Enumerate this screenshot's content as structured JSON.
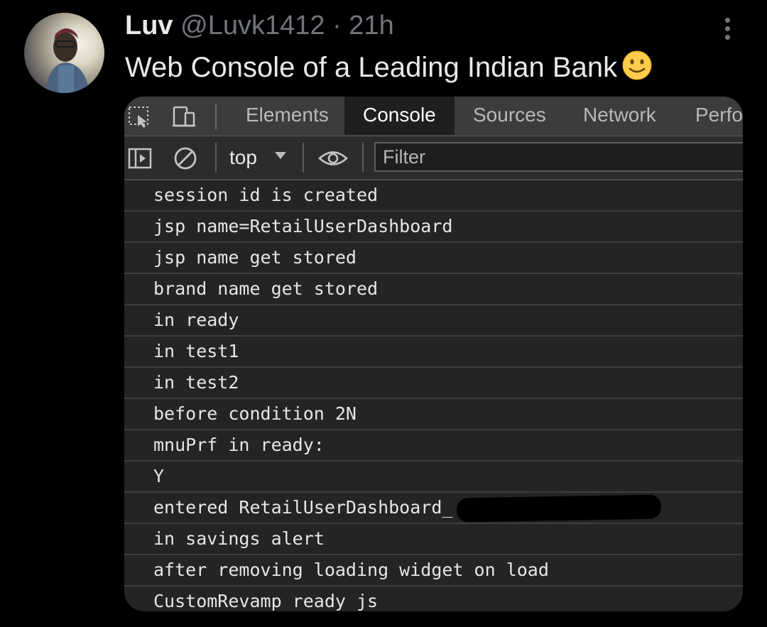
{
  "tweet": {
    "author_name": "Luv",
    "handle": "@Luvk1412",
    "separator": "·",
    "time": "21h",
    "text": "Web Console of a Leading Indian Bank",
    "emoji": "slightly-smiling-face-emoji",
    "avatar": "profile-photo",
    "more_icon": "more-options-icon"
  },
  "devtools": {
    "tabs": [
      {
        "label": "Elements",
        "active": false
      },
      {
        "label": "Console",
        "active": true
      },
      {
        "label": "Sources",
        "active": false
      },
      {
        "label": "Network",
        "active": false
      },
      {
        "label": "Perfo",
        "active": false
      }
    ],
    "tool_icons": [
      "element-picker-icon",
      "device-toggle-icon"
    ],
    "toolbar": {
      "icons": [
        "sidebar-toggle-icon",
        "clear-console-icon",
        "eye-icon"
      ],
      "context": "top",
      "filter_placeholder": "Filter"
    },
    "logs": [
      "session id is created",
      "jsp name=RetailUserDashboard",
      "jsp name get stored",
      "brand name get stored",
      "in ready",
      "in test1",
      "in test2",
      "before condition 2N",
      "mnuPrf in ready:",
      "Y",
      "entered RetailUserDashboard_",
      "in savings alert",
      "after removing loading widget on load",
      "CustomRevamp ready js"
    ]
  },
  "colors": {
    "page_background": "#000000",
    "panel_background": "#242424",
    "tab_bar": "#3c3c3c",
    "active_tab": "#1f1f1f",
    "muted_text": "#71767b"
  }
}
